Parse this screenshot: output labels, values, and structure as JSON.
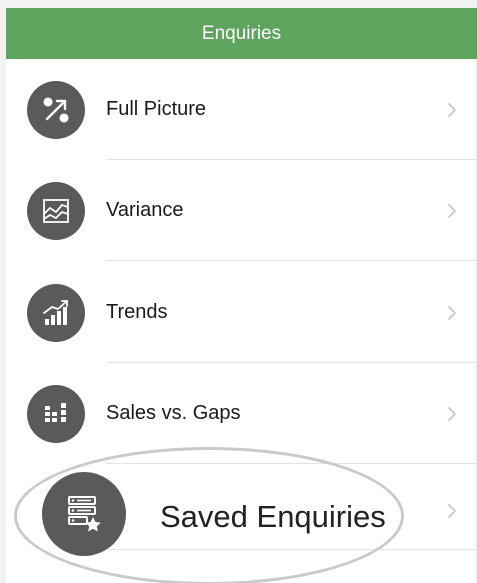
{
  "header": {
    "title": "Enquiries",
    "color": "#5ea35e"
  },
  "menu": {
    "items": [
      {
        "label": "Full Picture",
        "icon": "full-picture-icon"
      },
      {
        "label": "Variance",
        "icon": "variance-chart-icon"
      },
      {
        "label": "Trends",
        "icon": "trends-chart-icon"
      },
      {
        "label": "Sales vs. Gaps",
        "icon": "sales-gaps-icon"
      },
      {
        "label": "Saved Enquiries",
        "icon": "saved-enquiries-icon"
      }
    ]
  },
  "colors": {
    "icon_bg": "#5a5a5a",
    "chevron": "#c7c7cc",
    "highlight_ring": "#c9c9c9"
  }
}
